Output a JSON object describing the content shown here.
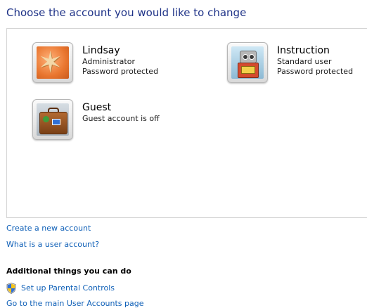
{
  "page": {
    "title": "Choose the account you would like to change"
  },
  "accounts": [
    {
      "name": "Lindsay",
      "lines": [
        "Administrator",
        "Password protected"
      ],
      "picture": "starfish-icon"
    },
    {
      "name": "Instruction",
      "lines": [
        "Standard user",
        "Password protected"
      ],
      "picture": "robot-icon"
    },
    {
      "name": "Guest",
      "lines": [
        "Guest account is off"
      ],
      "picture": "suitcase-icon"
    }
  ],
  "links": {
    "create_account": "Create a new account",
    "what_is": "What is a user account?"
  },
  "additional": {
    "heading": "Additional things you can do",
    "parental_controls": "Set up Parental Controls",
    "parental_icon": "shield-icon",
    "main_page": "Go to the main User Accounts page"
  },
  "colors": {
    "title": "#1e3287",
    "link": "#0e5fb7",
    "panel_border": "#d5d5d5"
  }
}
